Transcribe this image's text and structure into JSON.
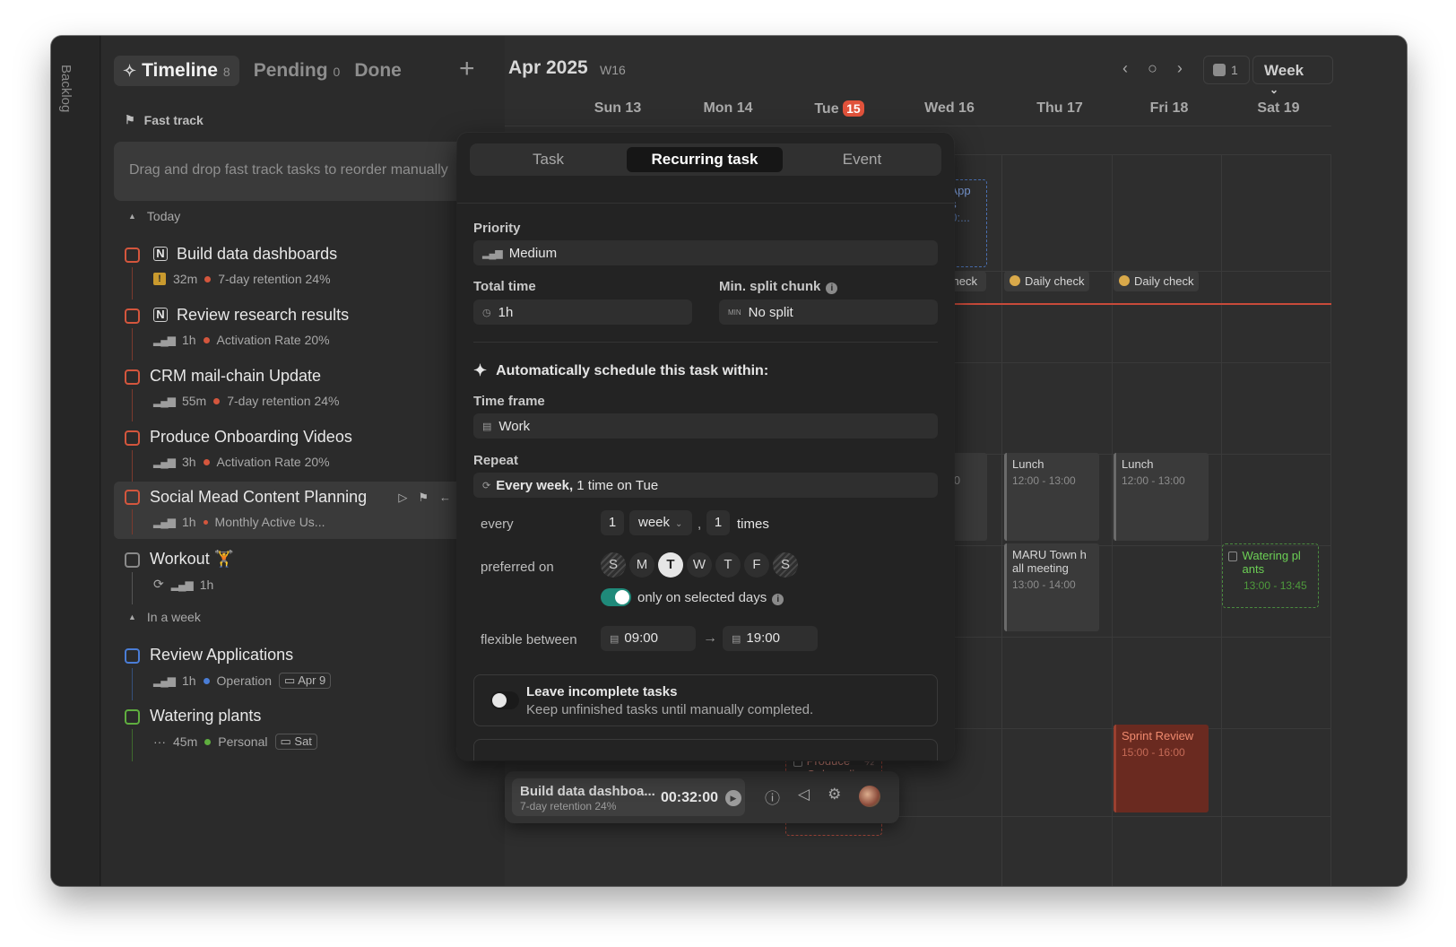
{
  "backlog": {
    "label": "Backlog"
  },
  "sidebar": {
    "tabs": [
      {
        "label": "Timeline",
        "count": "8"
      },
      {
        "label": "Pending",
        "count": "0"
      },
      {
        "label": "Done"
      }
    ],
    "fast_track": {
      "title": "Fast track",
      "placeholder": "Drag and drop fast track tasks to reorder manually"
    },
    "section_today": "Today",
    "section_week": "In a week",
    "tasks": [
      {
        "title": "Build data dashboards",
        "duration": "32m",
        "goal": "7-day retention 24%",
        "goal_color": "#d4563d"
      },
      {
        "title": "Review research results",
        "duration": "1h",
        "goal": "Activation Rate 20%",
        "goal_color": "#d4563d"
      },
      {
        "title": "CRM mail-chain Update",
        "duration": "55m",
        "goal": "7-day retention 24%",
        "goal_color": "#d4563d"
      },
      {
        "title": "Produce Onboarding Videos",
        "duration": "3h",
        "goal": "Activation Rate 20%",
        "goal_color": "#d4563d"
      },
      {
        "title": "Social Mead Content Planning",
        "duration": "1h",
        "goal": "Monthly Active Us...",
        "goal_color": "#d4563d"
      },
      {
        "title": "Workout 🏋",
        "duration": "1h"
      },
      {
        "title": "Review Applications",
        "duration": "1h",
        "goal": "Operation",
        "goal_color": "#4a7dd6",
        "date": "Apr 9"
      },
      {
        "title": "Watering plants",
        "duration": "45m",
        "goal": "Personal",
        "goal_color": "#5fae3f",
        "date": "Sat"
      }
    ]
  },
  "calendar": {
    "month": "Apr 2025",
    "week": "W16",
    "count": "1",
    "view": "Week",
    "days": [
      {
        "label": "Sun 13"
      },
      {
        "label": "Mon 14"
      },
      {
        "label": "Tue",
        "num": "15"
      },
      {
        "label": "Wed 16"
      },
      {
        "label": "Thu 17"
      },
      {
        "label": "Fri 18"
      },
      {
        "label": "Sat 19"
      }
    ],
    "events": {
      "app_partial": [
        "/ App",
        "ns",
        "10:..."
      ],
      "check_partial": "check",
      "daily_check": "Daily check",
      "lunch_title": "Lunch",
      "lunch_time": "12:00 - 13:00",
      "partial_00": ":00",
      "maru_title": "MARU Town h all meeting",
      "maru_time": "13:00 - 14:00",
      "watering_title": "Watering pl ants",
      "watering_time": "13:00 - 13:45",
      "sprint_title": "Sprint Review",
      "sprint_time": "15:00 - 16:00",
      "produce_title": "Produce Onboardi",
      "produce_frac": "½"
    }
  },
  "bottombar": {
    "title": "Build data dashboa...",
    "subtitle": "7-day retention 24%",
    "timer": "00:32:00"
  },
  "modal": {
    "tabs": [
      "Task",
      "Recurring task",
      "Event"
    ],
    "priority_label": "Priority",
    "priority_value": "Medium",
    "total_time_label": "Total time",
    "total_time_value": "1h",
    "min_split_label": "Min. split chunk",
    "min_split_value": "No split",
    "min_split_icon": "MIN",
    "auto_title": "Automatically schedule this task within:",
    "timeframe_label": "Time frame",
    "timeframe_value": "Work",
    "repeat_label": "Repeat",
    "repeat_value_bold": "Every week,",
    "repeat_value_rest": " 1 time on Tue",
    "every_label": "every",
    "every_num": "1",
    "every_unit": "week",
    "comma": ",",
    "times_num": "1",
    "times_label": "times",
    "preferred_label": "preferred on",
    "days": [
      "S",
      "M",
      "T",
      "W",
      "T",
      "F",
      "S"
    ],
    "only_selected": "only on selected days",
    "flexible_label": "flexible between",
    "from_time": "09:00",
    "to_time": "19:00",
    "leave_title": "Leave incomplete tasks",
    "leave_sub": "Keep unfinished tasks until manually completed."
  }
}
